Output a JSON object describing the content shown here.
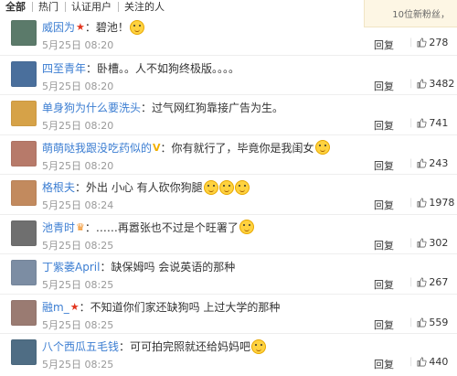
{
  "tabs": [
    "全部",
    "热门",
    "认证用户",
    "关注的人"
  ],
  "notice": "10位新粉丝，",
  "reply_label": "回复",
  "comments": [
    {
      "user": "威因为",
      "badge": "★",
      "badge_color": "red",
      "text": "：碧池！",
      "emoji": true,
      "time": "5月25日 08:20",
      "likes": "278",
      "avatar_color": "#5b7a6a"
    },
    {
      "user": "四至青年",
      "badge": "",
      "badge_color": "",
      "text": "：卧槽。。人不如狗终极版。。。。",
      "emoji": false,
      "time": "5月25日 08:20",
      "likes": "3482",
      "avatar_color": "#4a6f9c"
    },
    {
      "user": "单身狗为什么要洗头",
      "badge": "",
      "badge_color": "",
      "text": "：过气网红狗靠接广告为生。",
      "emoji": false,
      "time": "5月25日 08:20",
      "likes": "741",
      "avatar_color": "#d6a248"
    },
    {
      "user": "萌萌哒我跟没吃药似的",
      "badge": "V",
      "badge_color": "gold",
      "text": "：你有就行了，毕竟你是我闺女",
      "emoji": true,
      "time": "5月25日 08:20",
      "likes": "243",
      "avatar_color": "#b77a6a"
    },
    {
      "user": "格根夫",
      "badge": "",
      "badge_color": "",
      "text": "：外出 小心 有人砍你狗腿",
      "emoji": true,
      "emoji_count": 3,
      "time": "5月25日 08:24",
      "likes": "1978",
      "avatar_color": "#c28a5e"
    },
    {
      "user": "池青时",
      "badge": "♛",
      "badge_color": "orange",
      "text": "：……再嚣张也不过是个旺署了",
      "emoji": true,
      "time": "5月25日 08:25",
      "likes": "302",
      "avatar_color": "#6f6f6f"
    },
    {
      "user": "丁紫萎April",
      "badge": "",
      "badge_color": "",
      "text": "：缺保姆吗 会说英语的那种",
      "emoji": false,
      "time": "5月25日 08:25",
      "likes": "267",
      "avatar_color": "#7c8da3"
    },
    {
      "user": "融m_",
      "badge": "★",
      "badge_color": "red",
      "text": "：不知道你们家还缺狗吗 上过大学的那种",
      "emoji": false,
      "time": "5月25日 08:25",
      "likes": "559",
      "avatar_color": "#9a7b72"
    },
    {
      "user": "八个西瓜五毛钱",
      "badge": "",
      "badge_color": "",
      "text": "：可可拍完照就还给妈妈吧",
      "emoji": true,
      "time": "5月25日 08:25",
      "likes": "440",
      "avatar_color": "#4f6d84"
    }
  ]
}
